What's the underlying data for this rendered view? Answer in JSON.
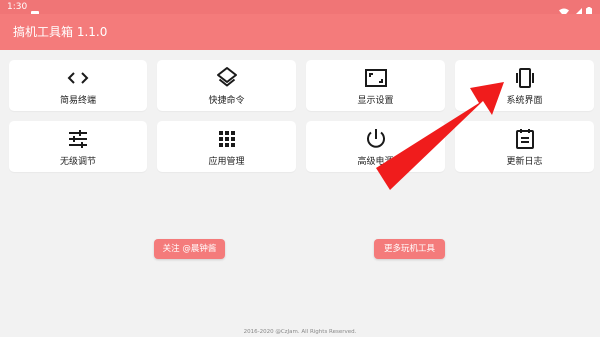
{
  "status_bar": {
    "time": "1:30"
  },
  "app_bar": {
    "title": "搞机工具箱 1.1.0"
  },
  "tiles": [
    {
      "label": "简易终端",
      "icon": "code-icon"
    },
    {
      "label": "快捷命令",
      "icon": "layers-icon"
    },
    {
      "label": "显示设置",
      "icon": "aspect-ratio-icon"
    },
    {
      "label": "系统界面",
      "icon": "vibration-icon"
    },
    {
      "label": "无级调节",
      "icon": "tune-icon"
    },
    {
      "label": "应用管理",
      "icon": "apps-grid-icon"
    },
    {
      "label": "高级电源",
      "icon": "power-icon"
    },
    {
      "label": "更新日志",
      "icon": "notes-icon"
    }
  ],
  "buttons": {
    "follow": "关注 @晨钟酱",
    "more": "更多玩机工具"
  },
  "footer": {
    "copyright": "2016-2020 @CzJam. All Rights Reserved."
  },
  "colors": {
    "accent": "#f47b7b",
    "arrow": "#f01c1c",
    "background": "#f2f2f2"
  }
}
